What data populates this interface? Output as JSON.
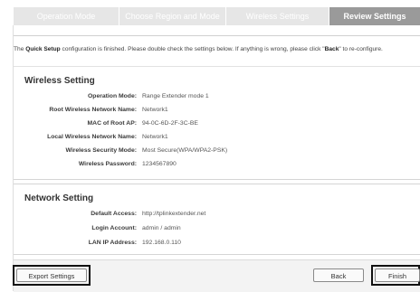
{
  "steps": [
    {
      "label": "Operation Mode",
      "active": false
    },
    {
      "label": "Choose Region and Mode",
      "active": false
    },
    {
      "label": "Wireless Settings",
      "active": false
    },
    {
      "label": "Review Settings",
      "active": true
    }
  ],
  "intro": {
    "prefix": "The ",
    "bold1": "Quick Setup",
    "middle": " configuration is finished. Please double check the settings below. If anything is wrong, please click \"",
    "bold2": "Back",
    "suffix": "\" to re-configure."
  },
  "wireless": {
    "title": "Wireless Setting",
    "rows": [
      {
        "label": "Operation Mode:",
        "value": "Range Extender mode 1"
      },
      {
        "label": "Root Wireless Network Name:",
        "value": "Network1"
      },
      {
        "label": "MAC of Root AP:",
        "value": "94-0C-6D-2F-3C-BE"
      },
      {
        "label": "Local Wireless Network Name:",
        "value": "Network1"
      },
      {
        "label": "Wireless Security Mode:",
        "value": "Most Secure(WPA/WPA2-PSK)"
      },
      {
        "label": "Wireless Password:",
        "value": "1234567890"
      }
    ]
  },
  "network": {
    "title": "Network Setting",
    "rows": [
      {
        "label": "Default Access:",
        "value": "http://tplinkextender.net"
      },
      {
        "label": "Login Account:",
        "value": "admin / admin"
      },
      {
        "label": "LAN IP Address:",
        "value": "192.168.0.110"
      }
    ]
  },
  "buttons": {
    "export": "Export Settings",
    "back": "Back",
    "finish": "Finish"
  }
}
